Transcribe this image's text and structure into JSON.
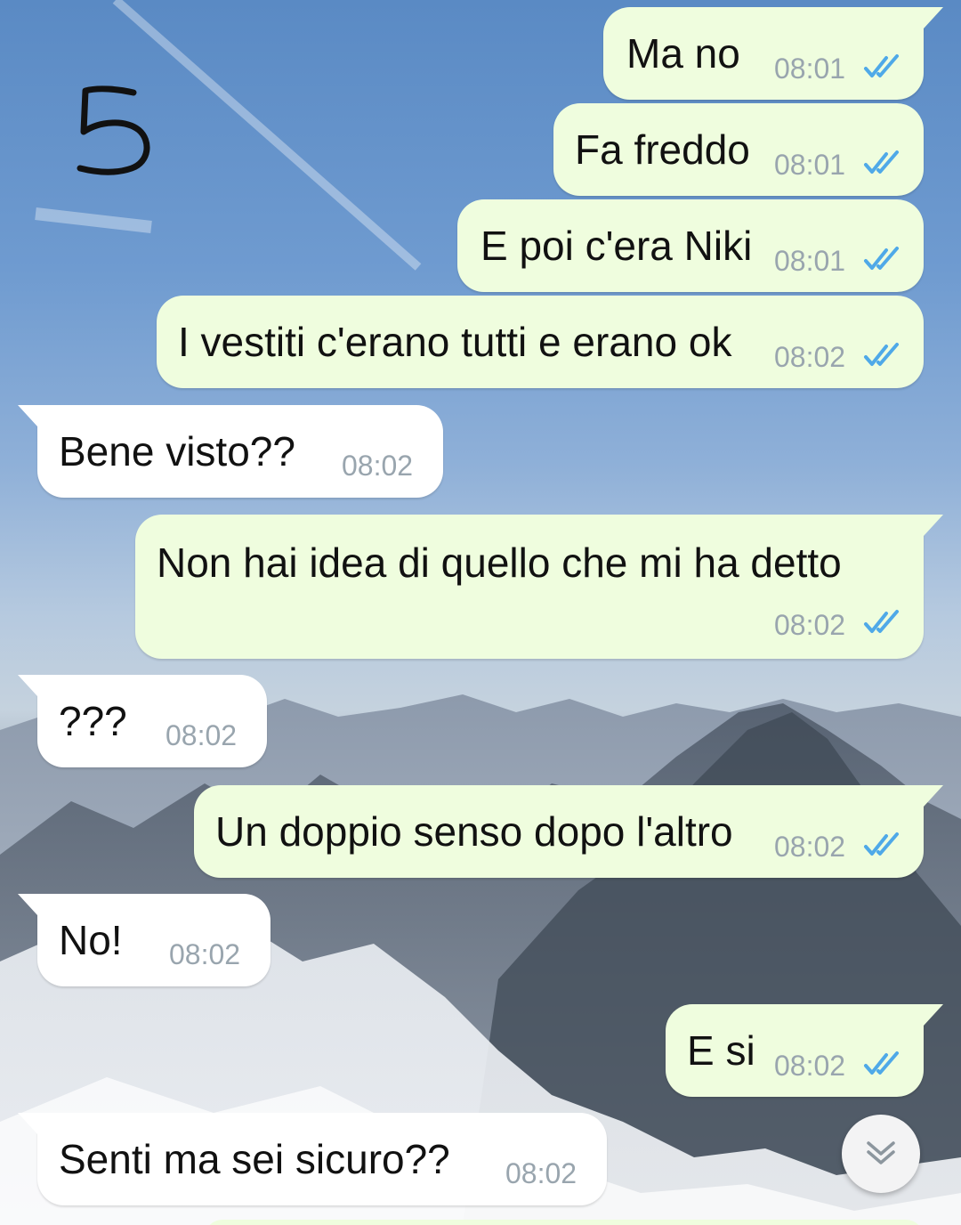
{
  "annotation": "5",
  "messages": [
    {
      "id": "m1",
      "direction": "outgoing",
      "text": "Ma no",
      "time": "08:01",
      "status": "read"
    },
    {
      "id": "m2",
      "direction": "outgoing",
      "text": "Fa freddo",
      "time": "08:01",
      "status": "read"
    },
    {
      "id": "m3",
      "direction": "outgoing",
      "text": "E poi c'era Niki",
      "time": "08:01",
      "status": "read"
    },
    {
      "id": "m4",
      "direction": "outgoing",
      "text": "I vestiti c'erano tutti e erano ok",
      "time": "08:02",
      "status": "read"
    },
    {
      "id": "m5",
      "direction": "incoming",
      "text": "Bene visto??",
      "time": "08:02"
    },
    {
      "id": "m6",
      "direction": "outgoing",
      "text": "Non hai idea di quello che mi ha detto",
      "time": "08:02",
      "status": "read"
    },
    {
      "id": "m7",
      "direction": "incoming",
      "text": "???",
      "time": "08:02"
    },
    {
      "id": "m8",
      "direction": "outgoing",
      "text": "Un doppio senso dopo l'altro",
      "time": "08:02",
      "status": "read"
    },
    {
      "id": "m9",
      "direction": "incoming",
      "text": "No!",
      "time": "08:02"
    },
    {
      "id": "m10",
      "direction": "outgoing",
      "text": "E si",
      "time": "08:02",
      "status": "read"
    },
    {
      "id": "m11",
      "direction": "incoming",
      "text": "Senti ma sei sicuro??",
      "time": "08:02"
    }
  ],
  "icons": {
    "read_receipt": "double-check-icon",
    "scroll_down": "chevron-double-down-icon"
  },
  "colors": {
    "outgoing_bubble": "#effdde",
    "incoming_bubble": "#ffffff",
    "time_text": "#99a5ae",
    "read_check": "#4fa9e8"
  }
}
